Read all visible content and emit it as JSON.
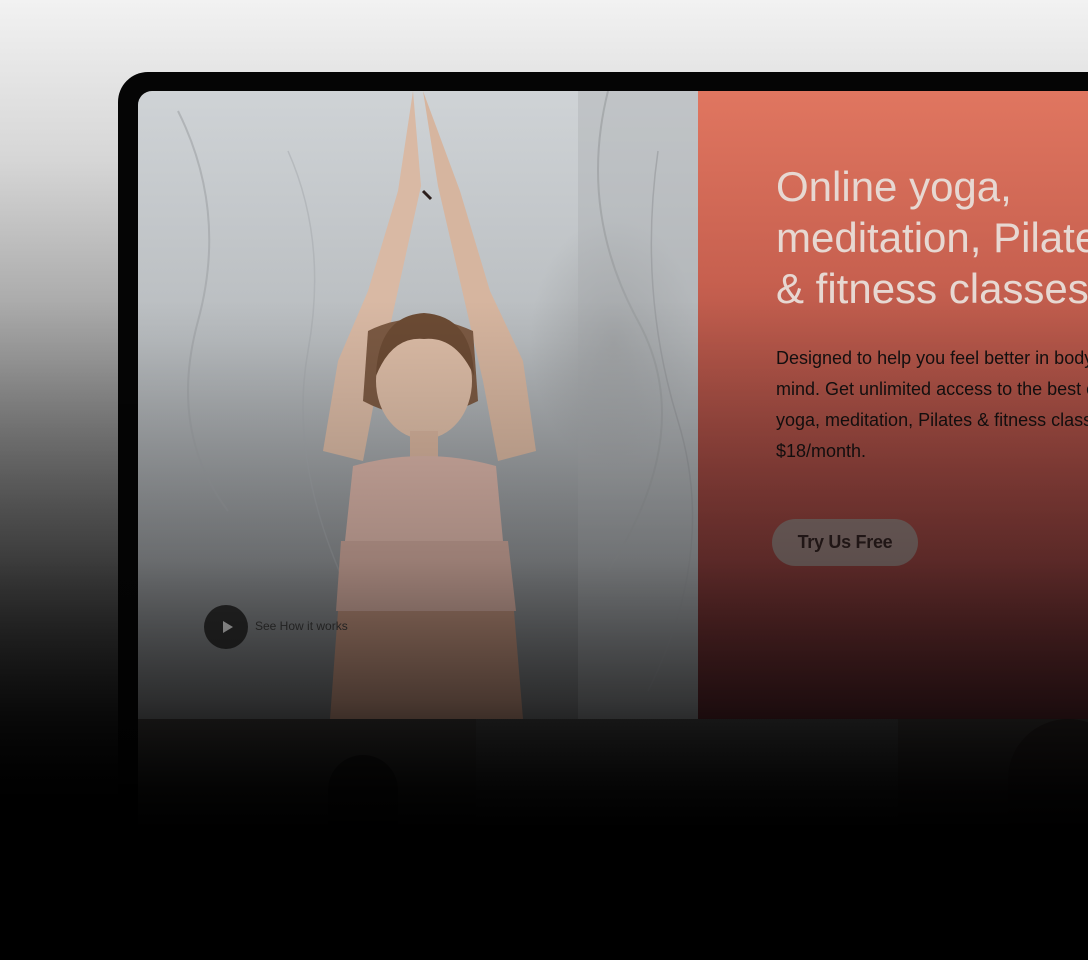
{
  "hero": {
    "title": "Online yoga,\nmeditation, Pilates\n& fitness classes",
    "description": "Designed to help you feel better in body and mind. Get unlimited access to the best online yoga, meditation, Pilates & fitness classes for $18/month.",
    "cta_label": "Try Us Free",
    "video_link_label": "See How it works",
    "photo_alt": "woman in yoga pose with arms raised"
  },
  "colors": {
    "accent": "#e07660",
    "panel_dark": "#4f2227"
  },
  "icons": {
    "play": "play-icon"
  }
}
